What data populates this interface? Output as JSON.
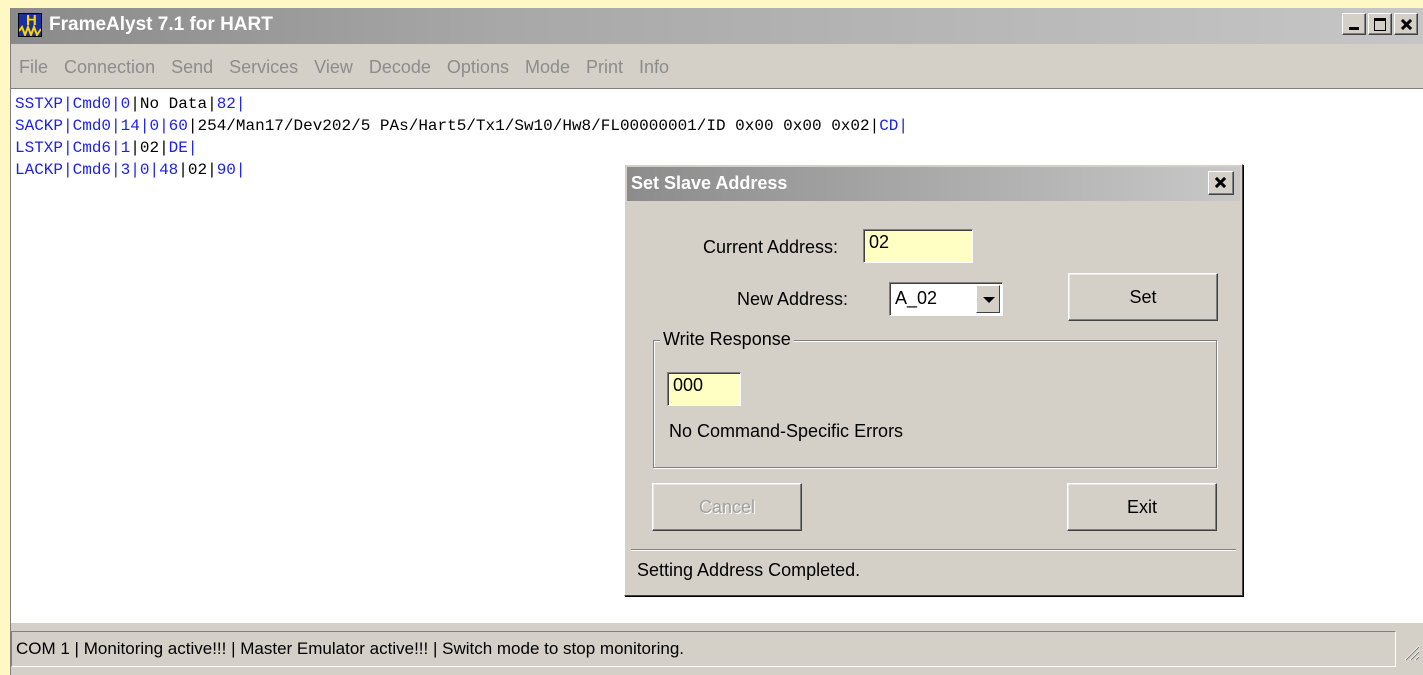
{
  "window": {
    "title": "FrameAlyst 7.1 for HART",
    "icon": "hart-wave-icon"
  },
  "menu": [
    "File",
    "Connection",
    "Send",
    "Services",
    "View",
    "Decode",
    "Options",
    "Mode",
    "Print",
    "Info"
  ],
  "log": {
    "lines": [
      [
        {
          "t": "SSTXP",
          "c": "blue"
        },
        {
          "t": "|",
          "c": "blue"
        },
        {
          "t": "Cmd0",
          "c": "blue"
        },
        {
          "t": "|",
          "c": "blue"
        },
        {
          "t": "0",
          "c": "blue"
        },
        {
          "t": "|",
          "c": "black"
        },
        {
          "t": "No Data",
          "c": "black"
        },
        {
          "t": "|",
          "c": "black"
        },
        {
          "t": "82",
          "c": "blue"
        },
        {
          "t": "|",
          "c": "blue"
        }
      ],
      [
        {
          "t": "SACKP",
          "c": "blue"
        },
        {
          "t": "|",
          "c": "blue"
        },
        {
          "t": "Cmd0",
          "c": "blue"
        },
        {
          "t": "|",
          "c": "blue"
        },
        {
          "t": "14",
          "c": "blue"
        },
        {
          "t": "|",
          "c": "blue"
        },
        {
          "t": "0",
          "c": "blue"
        },
        {
          "t": "|",
          "c": "blue"
        },
        {
          "t": "60",
          "c": "blue"
        },
        {
          "t": "|",
          "c": "black"
        },
        {
          "t": "254/Man17/Dev202/5 PAs/Hart5/Tx1/Sw10/Hw8/FL00000001/ID 0x00 0x00 0x02",
          "c": "black"
        },
        {
          "t": "|",
          "c": "black"
        },
        {
          "t": "CD",
          "c": "blue"
        },
        {
          "t": "|",
          "c": "blue"
        }
      ],
      [
        {
          "t": "LSTXP",
          "c": "blue"
        },
        {
          "t": "|",
          "c": "blue"
        },
        {
          "t": "Cmd6",
          "c": "blue"
        },
        {
          "t": "|",
          "c": "blue"
        },
        {
          "t": "1",
          "c": "blue"
        },
        {
          "t": "|",
          "c": "black"
        },
        {
          "t": "02",
          "c": "black"
        },
        {
          "t": "|",
          "c": "black"
        },
        {
          "t": "DE",
          "c": "blue"
        },
        {
          "t": "|",
          "c": "blue"
        }
      ],
      [
        {
          "t": "LACKP",
          "c": "blue"
        },
        {
          "t": "|",
          "c": "blue"
        },
        {
          "t": "Cmd6",
          "c": "blue"
        },
        {
          "t": "|",
          "c": "blue"
        },
        {
          "t": "3",
          "c": "blue"
        },
        {
          "t": "|",
          "c": "blue"
        },
        {
          "t": "0",
          "c": "blue"
        },
        {
          "t": "|",
          "c": "blue"
        },
        {
          "t": "48",
          "c": "blue"
        },
        {
          "t": "|",
          "c": "black"
        },
        {
          "t": "02",
          "c": "black"
        },
        {
          "t": "|",
          "c": "black"
        },
        {
          "t": "90",
          "c": "blue"
        },
        {
          "t": "|",
          "c": "blue"
        }
      ]
    ]
  },
  "status": {
    "text": "COM 1 | Monitoring active!!! | Master Emulator active!!! | Switch mode to stop monitoring."
  },
  "dialog": {
    "title": "Set Slave Address",
    "current_address_label": "Current Address:",
    "current_address_value": "02",
    "new_address_label": "New Address:",
    "new_address_value": "A_02",
    "set_label": "Set",
    "write_response_label": "Write Response",
    "write_response_value": "000",
    "write_response_message": "No Command-Specific Errors",
    "cancel_label": "Cancel",
    "exit_label": "Exit",
    "status_text": "Setting Address Completed."
  },
  "colors": {
    "accent_blue": "#1e22e6",
    "field_yellow": "#ffffc4",
    "background": "#fff8c4"
  }
}
